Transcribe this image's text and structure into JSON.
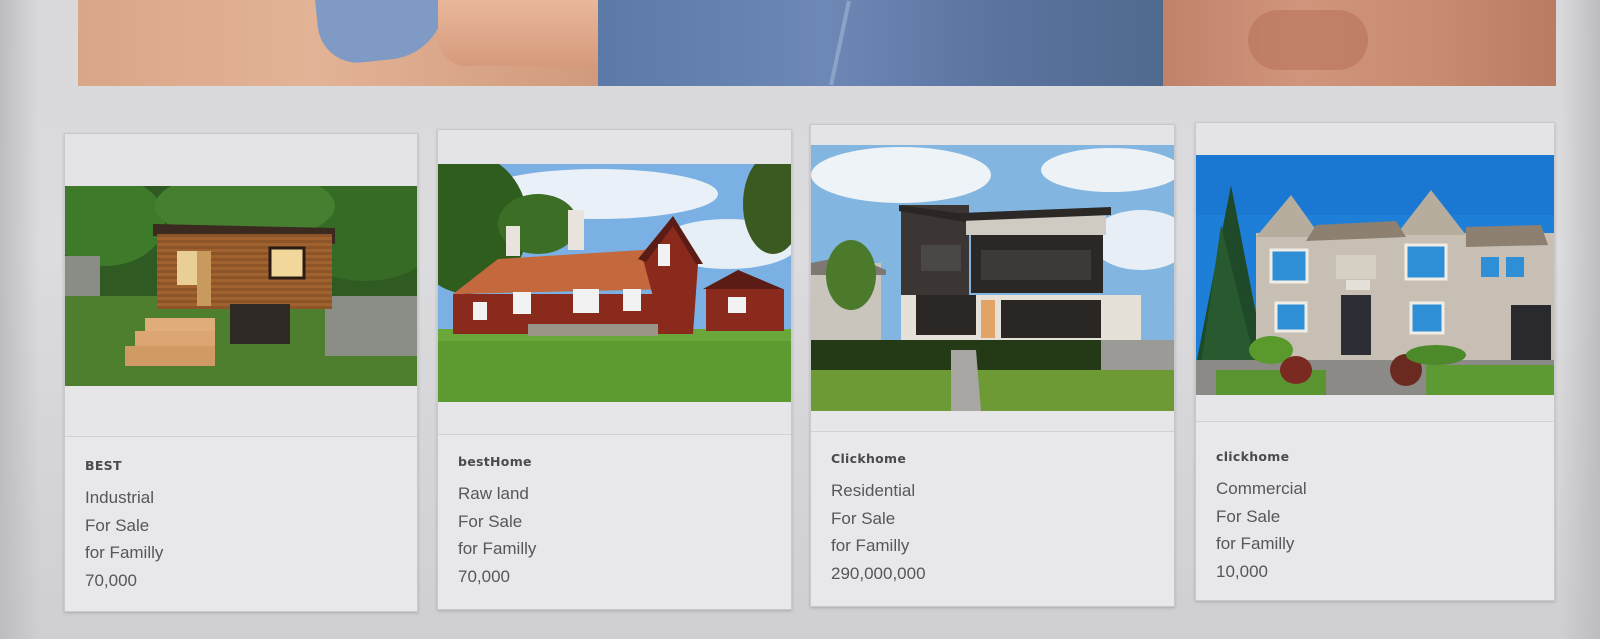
{
  "listings": [
    {
      "brand": "BEST",
      "category": "Industrial",
      "status": "For Sale",
      "audience": "for Familly",
      "price": "70,000"
    },
    {
      "brand": "bestHome",
      "category": "Raw land",
      "status": "For Sale",
      "audience": "for Familly",
      "price": "70,000"
    },
    {
      "brand": "Clickhome",
      "category": "Residential",
      "status": "For Sale",
      "audience": "for Familly",
      "price": "290,000,000"
    },
    {
      "brand": "clickhome",
      "category": "Commercial",
      "status": "For Sale",
      "audience": "for Familly",
      "price": "10,000"
    }
  ]
}
